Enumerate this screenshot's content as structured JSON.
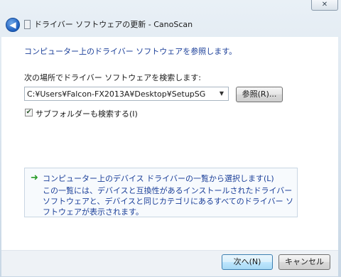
{
  "window": {
    "close_glyph": "✕",
    "back_glyph": "◀",
    "title": "ドライバー ソフトウェアの更新 - CanoScan"
  },
  "main": {
    "heading": "コンピューター上のドライバー ソフトウェアを参照します。",
    "search_label": "次の場所でドライバー ソフトウェアを検索します:",
    "path_value": "C:¥Users¥Falcon-FX2013A¥Desktop¥SetupSG",
    "browse_label": "参照(R)...",
    "subfolder_checked": true,
    "subfolder_label": "サブフォルダーも検索する(I)"
  },
  "pick_option": {
    "title": "コンピューター上のデバイス ドライバーの一覧から選択します(L)",
    "description": "この一覧には、デバイスと互換性があるインストールされたドライバー ソフトウェアと、デバイスと同じカテゴリにあるすべてのドライバー ソフトウェアが表示されます。",
    "icon": "green-arrow-icon"
  },
  "footer": {
    "next_label": "次へ(N)",
    "cancel_label": "キャンセル"
  },
  "colors": {
    "link_blue": "#1b3f99",
    "arrow_green": "#2a9d2a"
  }
}
